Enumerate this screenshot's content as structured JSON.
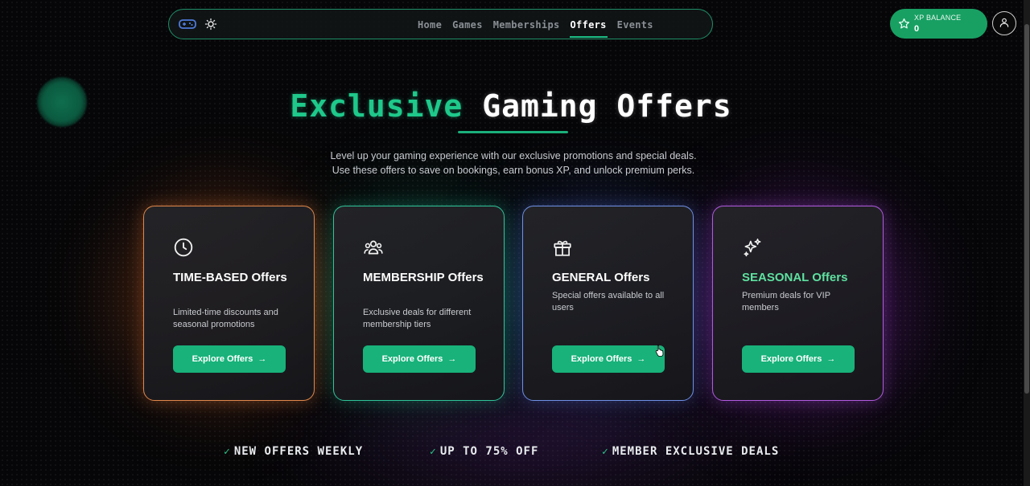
{
  "nav": {
    "links": [
      {
        "label": "Home"
      },
      {
        "label": "Games"
      },
      {
        "label": "Memberships"
      },
      {
        "label": "Offers"
      },
      {
        "label": "Events"
      }
    ],
    "active": "Offers",
    "logo_icon": "gamepad-icon",
    "theme_icon": "sun-icon"
  },
  "xp": {
    "label": "XP BALANCE",
    "value": "0",
    "icon": "star-icon"
  },
  "user": {
    "icon": "user-icon"
  },
  "hero": {
    "title_accent": "Exclusive",
    "title_rest": "Gaming Offers",
    "subtitle": "Level up your gaming experience with our exclusive promotions and special deals. Use these offers to save on bookings, earn bonus XP, and unlock premium perks."
  },
  "cards": [
    {
      "icon": "clock-icon",
      "title": "TIME-BASED Offers",
      "description": "Limited-time discounts and seasonal promotions",
      "button": "Explore Offers",
      "border_color": "#e0874a"
    },
    {
      "icon": "users-icon",
      "title": "MEMBERSHIP Offers",
      "description": "Exclusive deals for different membership tiers",
      "button": "Explore Offers",
      "border_color": "#2fc49a"
    },
    {
      "icon": "gift-icon",
      "title": "GENERAL Offers",
      "description": "Special offers available to all users",
      "button": "Explore Offers",
      "border_color": "#6f90e6"
    },
    {
      "icon": "sparkles-icon",
      "title": "SEASONAL Offers",
      "description": "Premium deals for VIP members",
      "button": "Explore Offers",
      "border_color": "#b15ae0"
    }
  ],
  "features": [
    {
      "check": "✓",
      "label": "NEW OFFERS WEEKLY"
    },
    {
      "check": "✓",
      "label": "UP TO 75% OFF"
    },
    {
      "check": "✓",
      "label": "MEMBER EXCLUSIVE DEALS"
    }
  ],
  "colors": {
    "accent": "#1ec98b",
    "button": "#18b27a",
    "xp_pill": "#18a063",
    "background": "#060608"
  }
}
